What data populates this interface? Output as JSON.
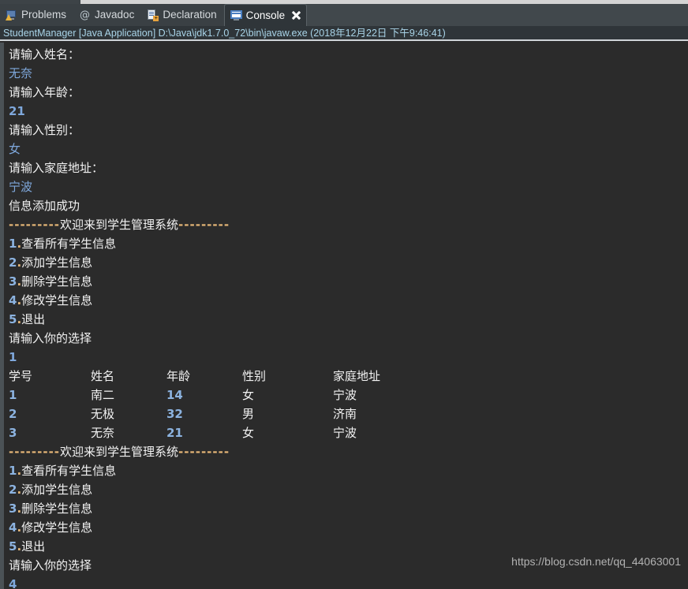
{
  "window": {
    "tabs": [
      {
        "label": "Problems",
        "icon": "problems-icon",
        "active": false
      },
      {
        "label": "Javadoc",
        "icon": "javadoc-icon",
        "active": false
      },
      {
        "label": "Declaration",
        "icon": "declaration-icon",
        "active": false
      },
      {
        "label": "Console",
        "icon": "console-icon",
        "active": true
      }
    ],
    "close_icon": "close-icon"
  },
  "process_header": "StudentManager [Java Application] D:\\Java\\jdk1.7.0_72\\bin\\javaw.exe (2018年12月22日 下午9:46:41)",
  "colors": {
    "console_background": "#2b2b2b",
    "output_text": "#f2f2f2",
    "input_text": "#7fa8dc",
    "header_text": "#a9d4e8",
    "tabbar_background": "#41484c",
    "active_tab_background": "#2f3539"
  },
  "console": {
    "banner": {
      "dashes_left": "---------",
      "title": "欢迎来到学生管理系统",
      "dashes_right": "---------"
    },
    "menu": [
      {
        "num": "1",
        "dot": ".",
        "label": "查看所有学生信息"
      },
      {
        "num": "2",
        "dot": ".",
        "label": "添加学生信息"
      },
      {
        "num": "3",
        "dot": ".",
        "label": "删除学生信息"
      },
      {
        "num": "4",
        "dot": ".",
        "label": "修改学生信息"
      },
      {
        "num": "5",
        "dot": ".",
        "label": "退出"
      }
    ],
    "prompts": {
      "name": "请输入姓名：",
      "age": "请输入年龄：",
      "gender": "请输入性别：",
      "address": "请输入家庭地址：",
      "success": "信息添加成功",
      "choice": "请输入你的选择"
    },
    "inputs": {
      "name": "无奈",
      "age": "21",
      "gender": "女",
      "address": "宁波",
      "choice_1": "1",
      "choice_2": "4"
    },
    "table": {
      "headers": [
        "学号",
        "姓名",
        "年龄",
        "性别",
        "家庭地址"
      ],
      "rows": [
        [
          "1",
          "南二",
          "14",
          "女",
          "宁波"
        ],
        [
          "2",
          "无极",
          "32",
          "男",
          "济南"
        ],
        [
          "3",
          "无奈",
          "21",
          "女",
          "宁波"
        ]
      ]
    }
  },
  "watermark": "https://blog.csdn.net/qq_44063001"
}
